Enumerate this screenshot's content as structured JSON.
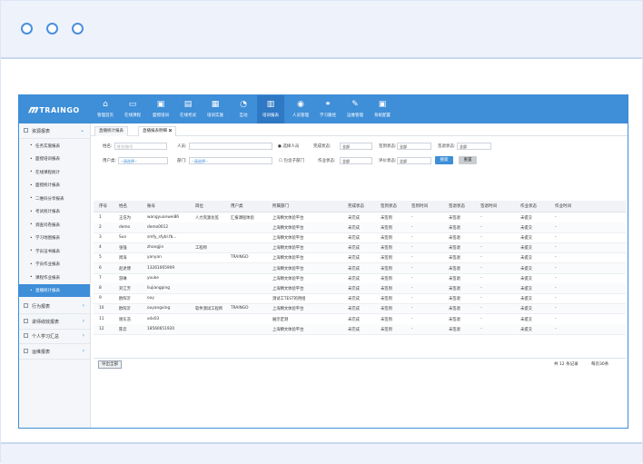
{
  "brand": {
    "name": "TRAINGO"
  },
  "top_nav": [
    {
      "label": "管理首页",
      "icon": "home-icon",
      "glyph": "⌂"
    },
    {
      "label": "在线课程",
      "icon": "monitor-icon",
      "glyph": "▭"
    },
    {
      "label": "面授培训",
      "icon": "projector-icon",
      "glyph": "▣"
    },
    {
      "label": "在线考试",
      "icon": "exam-icon",
      "glyph": "▤"
    },
    {
      "label": "培训实施",
      "icon": "chat-icon",
      "glyph": "▦"
    },
    {
      "label": "互动",
      "icon": "bubble-icon",
      "glyph": "◔"
    },
    {
      "label": "培训报表",
      "icon": "bar-chart-icon",
      "glyph": "▥"
    },
    {
      "label": "人员管理",
      "icon": "user-icon",
      "glyph": "◉"
    },
    {
      "label": "学习路径",
      "icon": "path-icon",
      "glyph": "⚭"
    },
    {
      "label": "运维管理",
      "icon": "edit-icon",
      "glyph": "✎"
    },
    {
      "label": "系统配置",
      "icon": "settings-icon",
      "glyph": "▣"
    }
  ],
  "sidebar": {
    "group_open": "资源报表",
    "items": [
      "任务实施报表",
      "面授培训报表",
      "在线课程统计",
      "面授统计报表",
      "二维码分享报表",
      "考试统计报表",
      "调查问卷报表",
      "学习地图报表",
      "学员证书报表",
      "学员作业报表",
      "课程作业报表",
      "直播统计报表"
    ],
    "groups_collapsed": [
      "行为报表",
      "讲师绩效报表",
      "个人学习汇总",
      "运维报表"
    ]
  },
  "tabs": [
    "直播统计报表",
    "直播报表明细"
  ],
  "filters": {
    "name_label": "姓名:",
    "name_placeholder": "姓名/账号",
    "person_label": "人员:",
    "select_person": "选择人员",
    "finish_status_label": "完成状态:",
    "finish_status_value": "全部",
    "visit_status_label": "签到状态:",
    "visit_status_value": "全部",
    "checkout_status_label": "签退状态:",
    "checkout_status_value": "全部",
    "user_class_label": "用户类:",
    "user_class_value": "--请选择--",
    "dept_label": "部门:",
    "dept_value": "--请选择--",
    "include_child_label": "包含子部门",
    "homework_status_label": "作业状态:",
    "homework_status_value": "全部",
    "eval_status_label": "评价状态:",
    "eval_status_value": "全部",
    "search_button": "搜索",
    "reset_button": "重置"
  },
  "table": {
    "headers": [
      "序号",
      "姓名",
      "账号",
      "岗位",
      "用户类",
      "所属部门",
      "完成状态",
      "签到状态",
      "签到时间",
      "签退状态",
      "签退时间",
      "作业状态",
      "作业时间"
    ],
    "rows": [
      [
        "1",
        "王浩为",
        "wangyuanwei86",
        "人力资源总监",
        "汇报课程体验",
        "上海精文体验平台",
        "未完成",
        "未签到",
        "-",
        "未签退",
        "-",
        "未提交",
        "-"
      ],
      [
        "2",
        "demo",
        "demo0612",
        "",
        "",
        "上海精文体验平台",
        "未完成",
        "未签到",
        "-",
        "未签退",
        "-",
        "未提交",
        "-"
      ],
      [
        "3",
        "Sun",
        "smfy_sfybl.fb...",
        "",
        "",
        "上海精文体验平台",
        "未完成",
        "未签到",
        "-",
        "未签退",
        "-",
        "未提交",
        "-"
      ],
      [
        "4",
        "张强",
        "zhangjin",
        "工程师",
        "",
        "上海精文体验平台",
        "未完成",
        "未签到",
        "-",
        "未签退",
        "-",
        "未提交",
        "-"
      ],
      [
        "5",
        "周海",
        "yanyan",
        "",
        "TRAINGO",
        "上海精文体验平台",
        "未完成",
        "未签到",
        "-",
        "未签退",
        "-",
        "未提交",
        "-"
      ],
      [
        "6",
        "赵述博",
        "13261065909",
        "",
        "",
        "上海精文体验平台",
        "未完成",
        "未签到",
        "-",
        "未签退",
        "-",
        "未提交",
        "-"
      ],
      [
        "7",
        "游琳",
        "youke",
        "",
        "",
        "上海精文体验平台",
        "未完成",
        "未签到",
        "-",
        "未签退",
        "-",
        "未提交",
        "-"
      ],
      [
        "8",
        "刘江芳",
        "liujiangping",
        "",
        "",
        "上海精文体验平台",
        "未完成",
        "未签到",
        "-",
        "未签退",
        "-",
        "未提交",
        "-"
      ],
      [
        "9",
        "欧阳沂",
        "ouy",
        "",
        "",
        "测试工TEST的用组",
        "未完成",
        "未签到",
        "-",
        "未签退",
        "-",
        "未提交",
        "-"
      ],
      [
        "10",
        "欧阳沂",
        "ouyangxing",
        "软件测试工程师",
        "TRAINGO",
        "上海精文体验平台",
        "未完成",
        "未签到",
        "-",
        "未签退",
        "-",
        "未提交",
        "-"
      ],
      [
        "11",
        "谢东浩",
        "xdx03",
        "",
        "",
        "展示定测",
        "未完成",
        "未签到",
        "-",
        "未签退",
        "-",
        "未提交",
        "-"
      ],
      [
        "12",
        "陈云",
        "18560651920",
        "",
        "",
        "上海精文体验平台",
        "未完成",
        "未签到",
        "-",
        "未签退",
        "-",
        "未提交",
        "-"
      ]
    ]
  },
  "footer": {
    "export_button": "导出全部",
    "total_text": "共 12 条记录",
    "page_size_text": "每页30条"
  }
}
